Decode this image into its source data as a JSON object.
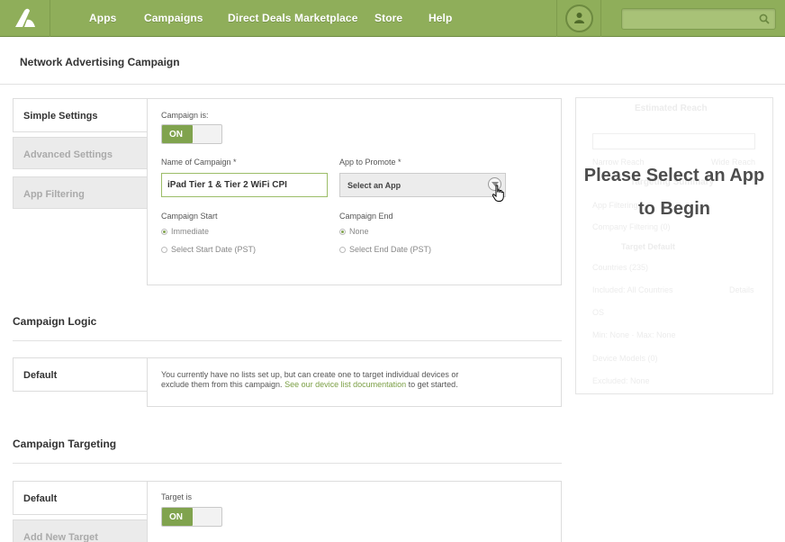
{
  "nav": {
    "items": [
      {
        "id": "apps",
        "label": "Apps"
      },
      {
        "id": "campaigns",
        "label": "Campaigns"
      },
      {
        "id": "direct-deals",
        "label": "Direct Deals Marketplace"
      },
      {
        "id": "store",
        "label": "Store"
      },
      {
        "id": "help",
        "label": "Help"
      }
    ],
    "search_value": "",
    "icons": {
      "logo": "chartboost-logo-icon",
      "avatar": "user-icon",
      "search": "search-icon"
    }
  },
  "page": {
    "title": "Network Advertising Campaign"
  },
  "tabs": [
    {
      "label": "Simple Settings",
      "active": true
    },
    {
      "label": "Advanced Settings",
      "active": false
    },
    {
      "label": "App Filtering",
      "active": false
    }
  ],
  "settings": {
    "campaign_is_label": "Campaign is:",
    "campaign_toggle": "ON",
    "name_label": "Name of Campaign *",
    "name_value": "iPad Tier 1 & Tier 2 WiFi CPI",
    "app_label": "App to Promote *",
    "app_selected": "Select an App",
    "start_label": "Campaign Start",
    "start_options": [
      "Immediate",
      "Select Start Date (PST)"
    ],
    "end_label": "Campaign End",
    "end_options": [
      "None",
      "Select End Date (PST)"
    ]
  },
  "logic": {
    "title": "Campaign Logic",
    "tab": "Default",
    "message_1": "You currently have no lists set up, but can create one to target individual devices or",
    "message_2a": "exclude them from this campaign. ",
    "message_link": "See our device list documentation",
    "message_2b": " to get started."
  },
  "targeting": {
    "title": "Campaign Targeting",
    "tab_default": "Default",
    "tab_add": "Add New Target",
    "target_is_label": "Target is",
    "target_toggle": "ON"
  },
  "reach": {
    "title": "Estimated Reach",
    "narrow": "Narrow Reach",
    "wide": "Wide Reach",
    "summary": "Targeting Summary",
    "app_filtering": "App Filtering",
    "company_filtering": "Company Filtering (0)",
    "target": "Target Default",
    "countries": "Countries (235)",
    "included": "Included: All Countries",
    "os": "OS",
    "min_max": "Min: None · Max: None",
    "device_models": "Device Models (0)",
    "excluded": "Excluded: None",
    "details": "Details",
    "overlay_message": "Please Select an App to Begin"
  },
  "colors": {
    "brand_green": "#8fae5a",
    "toggle_green": "#80a34e",
    "link_green": "#7b9f45"
  }
}
